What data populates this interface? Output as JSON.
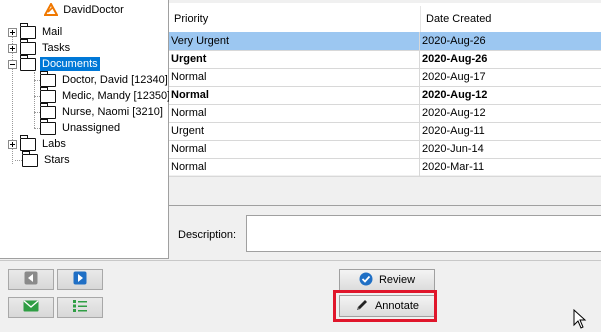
{
  "tree": {
    "root_label": "DavidDoctor",
    "items": [
      {
        "label": "Mail"
      },
      {
        "label": "Tasks"
      },
      {
        "label": "Documents"
      },
      {
        "label": "Doctor, David [12340]"
      },
      {
        "label": "Medic, Mandy [12350]"
      },
      {
        "label": "Nurse, Naomi [3210]"
      },
      {
        "label": "Unassigned"
      },
      {
        "label": "Labs"
      },
      {
        "label": "Stars"
      }
    ]
  },
  "list": {
    "columns": [
      "Priority",
      "Date Created"
    ],
    "rows": [
      {
        "priority": "Very Urgent",
        "date": "2020-Aug-26"
      },
      {
        "priority": "Urgent",
        "date": "2020-Aug-26"
      },
      {
        "priority": "Normal",
        "date": "2020-Aug-17"
      },
      {
        "priority": "Normal",
        "date": "2020-Aug-12"
      },
      {
        "priority": "Normal",
        "date": "2020-Aug-12"
      },
      {
        "priority": "Urgent",
        "date": "2020-Aug-11"
      },
      {
        "priority": "Normal",
        "date": "2020-Jun-14"
      },
      {
        "priority": "Normal",
        "date": "2020-Mar-11"
      }
    ]
  },
  "description": {
    "label": "Description:",
    "value": ""
  },
  "actions": {
    "review_label": "Review",
    "annotate_label": "Annotate"
  },
  "icons": {
    "root": "logo-icon",
    "folder": "folder-icon",
    "back": "arrow-left-icon",
    "forward": "arrow-right-icon",
    "mail": "mail-icon",
    "list": "list-icon",
    "review": "check-icon",
    "annotate": "pencil-icon"
  },
  "colors": {
    "selection": "#0078d7",
    "row_selected": "#9cc7f1",
    "highlight": "#e0162b"
  }
}
